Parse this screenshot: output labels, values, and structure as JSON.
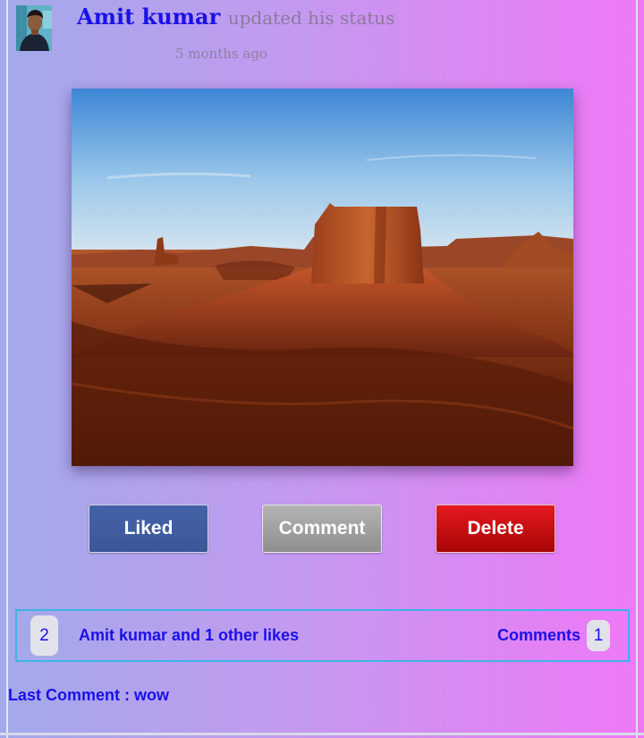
{
  "post": {
    "author": "Amit kumar",
    "action": "updated his status",
    "time": "5 months ago",
    "photo_subject": "desert-butte-photo"
  },
  "actions": {
    "liked_label": "Liked",
    "comment_label": "Comment",
    "delete_label": "Delete"
  },
  "stats": {
    "likes_count": "2",
    "likes_text": "Amit kumar and 1 other likes",
    "comments_label": "Comments",
    "comments_count": "1"
  },
  "last_comment": "Last Comment : wow",
  "colors": {
    "link_blue": "#1a10e8",
    "liked_button": "#3a5898",
    "comment_button": "#9e9e9e",
    "delete_button": "#c40c12",
    "stats_border": "#3cb4e4"
  }
}
